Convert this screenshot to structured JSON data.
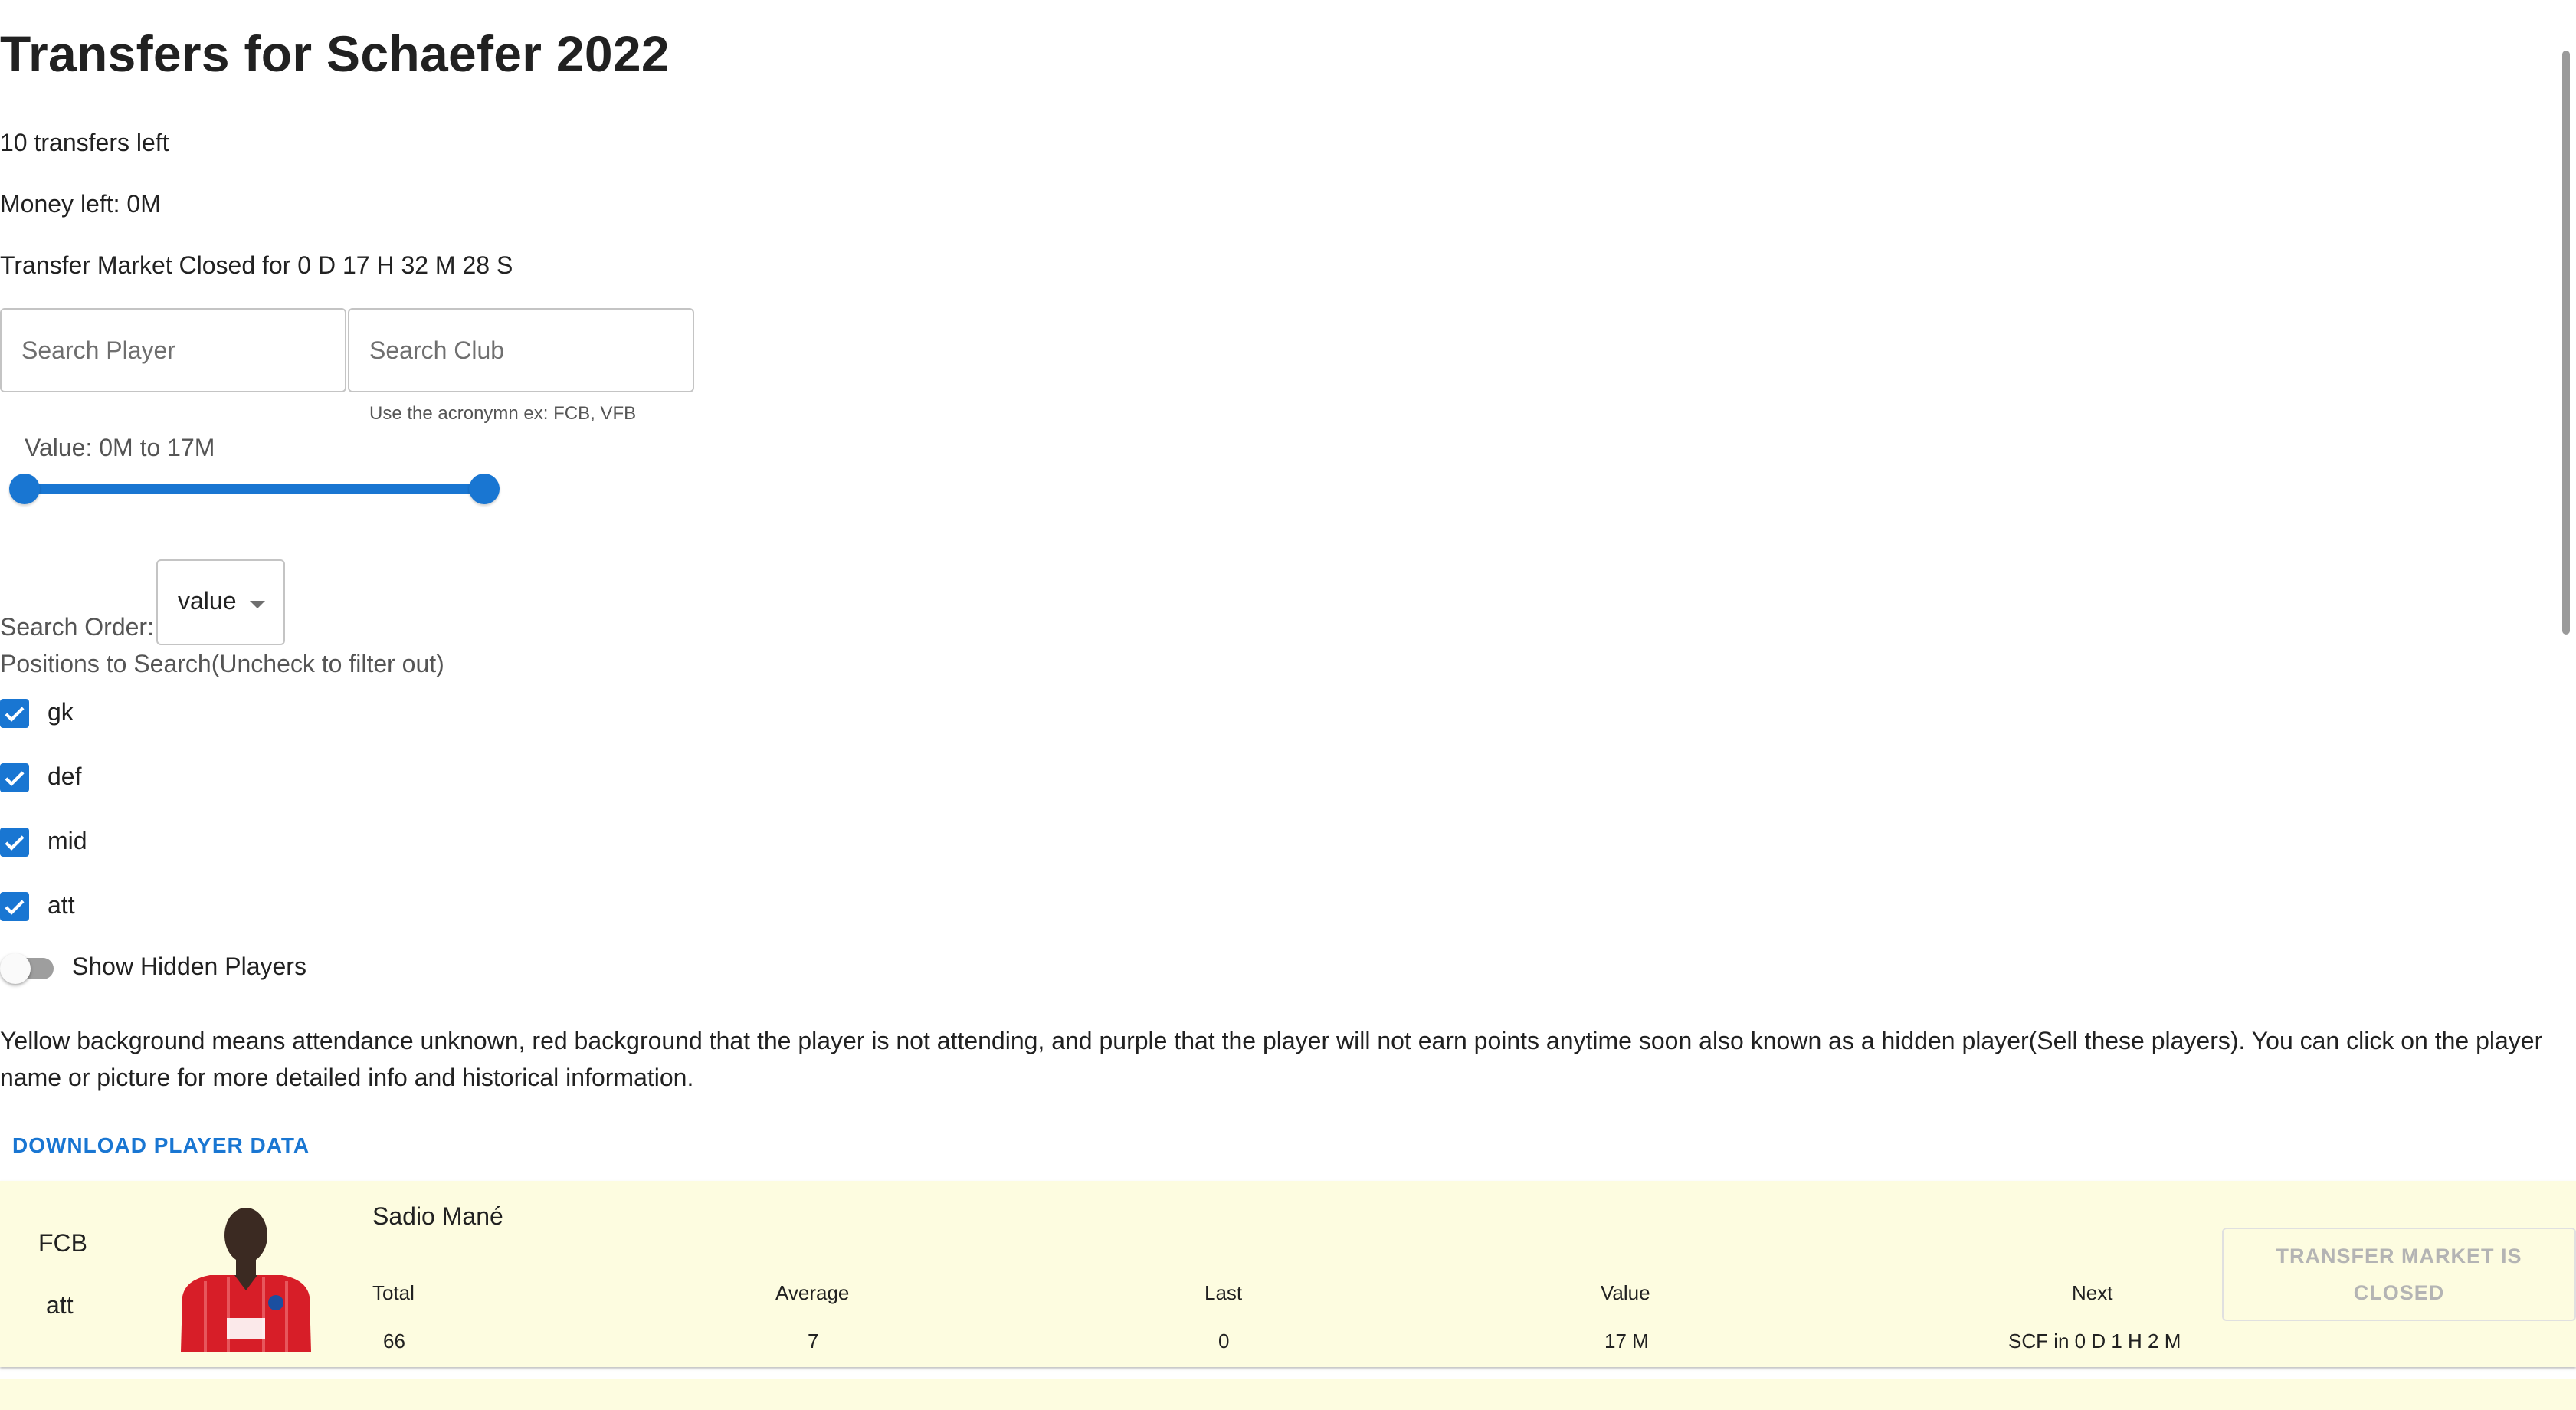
{
  "page": {
    "title": "Transfers for Schaefer 2022",
    "transfers_left": "10 transfers left",
    "money_left": "Money left: 0M",
    "market_status": "Transfer Market Closed for 0 D 17 H 32 M 28 S"
  },
  "search": {
    "player_placeholder": "Search Player",
    "club_placeholder": "Search Club",
    "club_helper": "Use the acronymn ex: FCB, VFB"
  },
  "value_slider": {
    "label": "Value: 0M to 17M",
    "min_fraction": 0.0,
    "max_fraction": 1.0
  },
  "order": {
    "label": "Search Order:",
    "selected": "value"
  },
  "positions": {
    "label": "Positions to Search(Uncheck to filter out)",
    "items": [
      {
        "label": "gk",
        "checked": true
      },
      {
        "label": "def",
        "checked": true
      },
      {
        "label": "mid",
        "checked": true
      },
      {
        "label": "att",
        "checked": true
      }
    ]
  },
  "hidden_toggle": {
    "label": "Show Hidden Players",
    "on": false
  },
  "info_text": "Yellow background means attendance unknown, red background that the player is not attending, and purple that the player will not earn points anytime soon also known as a hidden player(Sell these players). You can click on the player name or picture for more detailed info and historical information.",
  "download_label": "DOWNLOAD PLAYER DATA",
  "colors": {
    "accent": "#1976d2",
    "card_unknown_attendance": "#fdfce0"
  },
  "players": [
    {
      "club": "FCB",
      "position": "att",
      "name": "Sadio Mané",
      "headers": {
        "total": "Total",
        "average": "Average",
        "last": "Last",
        "value": "Value",
        "next": "Next"
      },
      "stats": {
        "total": "66",
        "average": "7",
        "last": "0",
        "value": "17 M",
        "next": "SCF in 0 D 1 H 2 M"
      },
      "action": "TRANSFER MARKET IS CLOSED"
    }
  ]
}
